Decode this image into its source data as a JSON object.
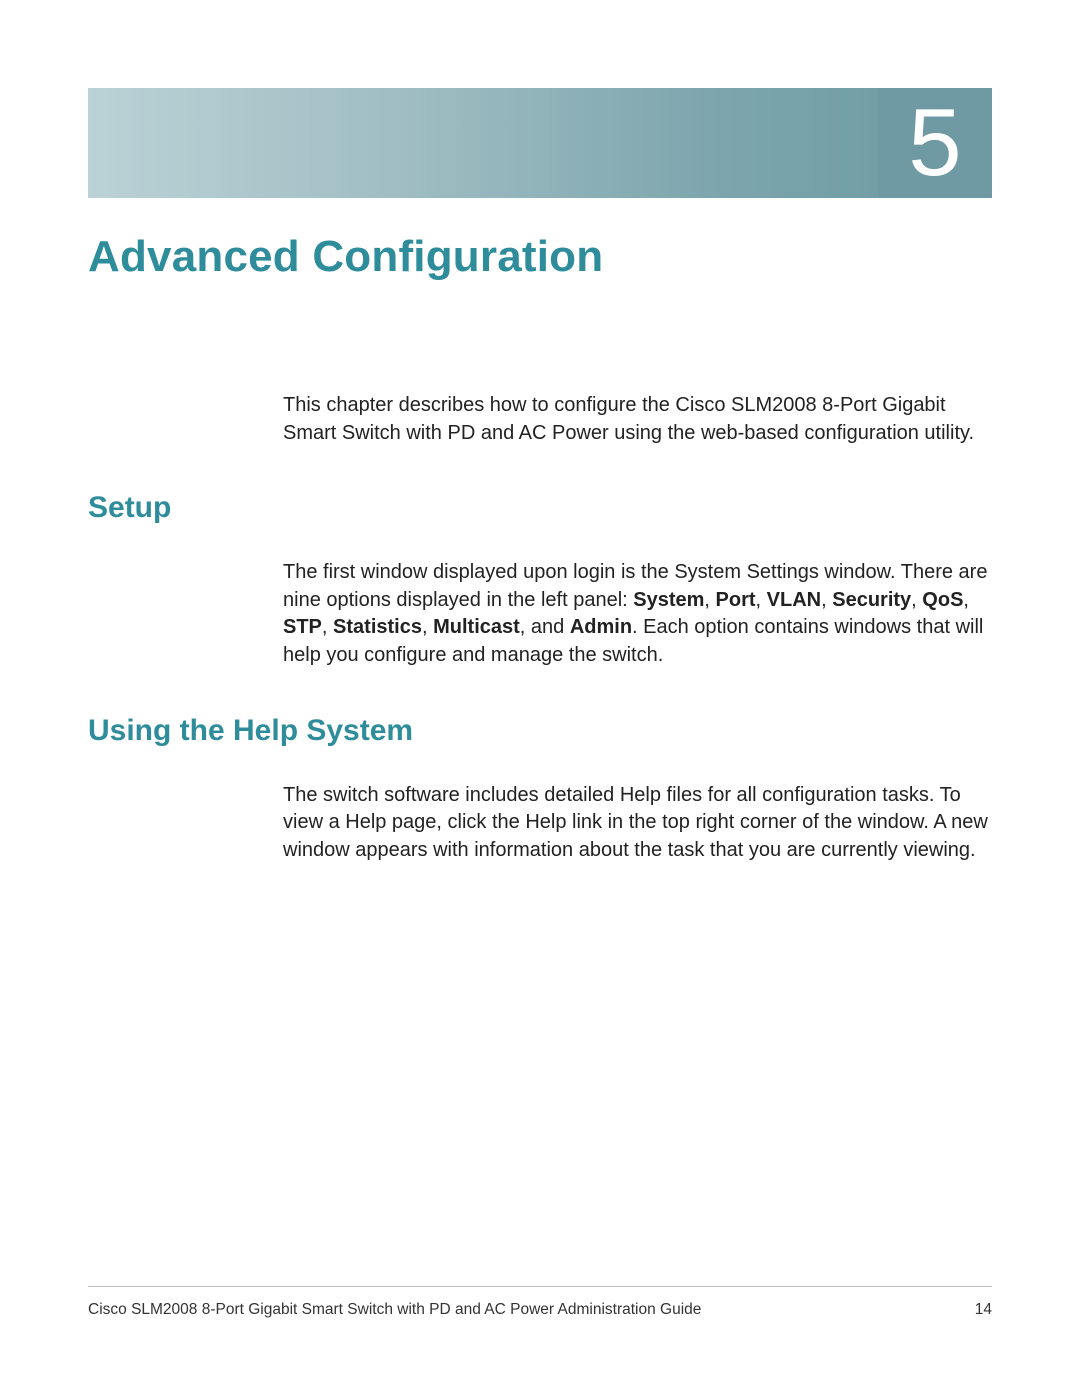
{
  "chapter": {
    "number": "5",
    "title": "Advanced Configuration"
  },
  "intro": {
    "text": "This chapter describes how to configure the Cisco SLM2008 8-Port Gigabit Smart Switch with PD and AC Power using the web-based configuration utility."
  },
  "sections": {
    "setup": {
      "heading": "Setup",
      "para_pre": "The first window displayed upon login is the System Settings window. There are nine options displayed in the left panel: ",
      "options": {
        "o1": "System",
        "c1": ", ",
        "o2": "Port",
        "c2": ", ",
        "o3": "VLAN",
        "c3": ", ",
        "o4": "Security",
        "c4": ", ",
        "o5": "QoS",
        "c5": ", ",
        "o6": "STP",
        "c6": ", ",
        "o7": "Statistics",
        "c7": ", ",
        "o8": "Multicast",
        "c8": ", and ",
        "o9": "Admin"
      },
      "para_post": ". Each option contains windows that will help you configure and manage the switch."
    },
    "help": {
      "heading": "Using the Help System",
      "para": "The switch software includes detailed Help files for all configuration tasks. To view a Help page, click the Help link in the top right corner of the window. A new window appears with information about the task that you are currently viewing."
    }
  },
  "footer": {
    "left": "Cisco SLM2008 8-Port Gigabit Smart Switch with PD and AC Power Administration Guide",
    "page": "14"
  }
}
